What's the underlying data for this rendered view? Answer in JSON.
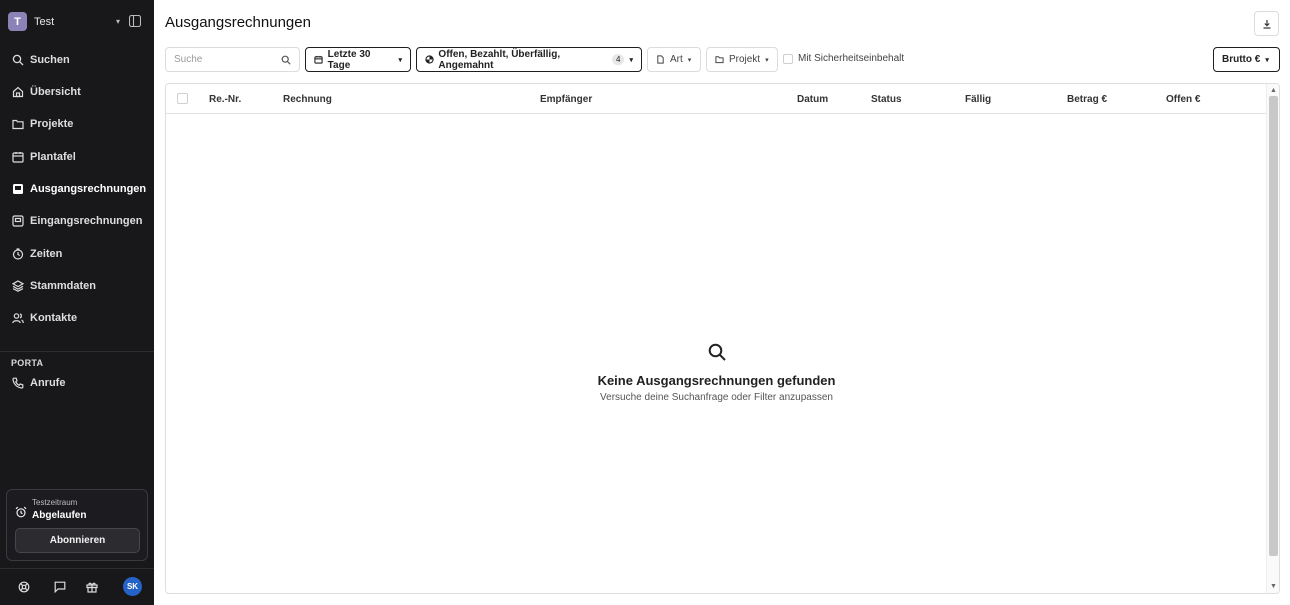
{
  "workspace": {
    "initial": "T",
    "name": "Test"
  },
  "sidebar": {
    "items": [
      {
        "label": "Suchen",
        "icon": "search-icon"
      },
      {
        "label": "Übersicht",
        "icon": "home-icon"
      },
      {
        "label": "Projekte",
        "icon": "folder-icon"
      },
      {
        "label": "Plantafel",
        "icon": "calendar-icon"
      },
      {
        "label": "Ausgangsrechnungen",
        "icon": "invoice-out-icon",
        "active": true
      },
      {
        "label": "Eingangsrechnungen",
        "icon": "invoice-in-icon"
      },
      {
        "label": "Zeiten",
        "icon": "clock-icon"
      },
      {
        "label": "Stammdaten",
        "icon": "layers-icon"
      },
      {
        "label": "Kontakte",
        "icon": "contacts-icon"
      }
    ],
    "section_label": "PORTA",
    "section_items": [
      {
        "label": "Anrufe",
        "icon": "phone-icon"
      }
    ],
    "trial": {
      "small": "Testzeitraum",
      "big": "Abgelaufen",
      "button": "Abonnieren"
    },
    "user_initials": "SK"
  },
  "main": {
    "title": "Ausgangsrechnungen",
    "search_placeholder": "Suche",
    "filters": {
      "date": "Letzte 30 Tage",
      "status": "Offen, Bezahlt, Überfällig, Angemahnt",
      "status_count": "4",
      "type": "Art",
      "project": "Projekt",
      "security": "Mit Sicherheitseinbehalt",
      "gross": "Brutto €"
    },
    "table": {
      "columns": [
        "Re.-Nr.",
        "Rechnung",
        "Empfänger",
        "Datum",
        "Status",
        "Fällig",
        "Betrag €",
        "Offen €"
      ]
    },
    "empty": {
      "title": "Keine Ausgangsrechnungen gefunden",
      "subtitle": "Versuche deine Suchanfrage oder Filter anzupassen"
    }
  }
}
